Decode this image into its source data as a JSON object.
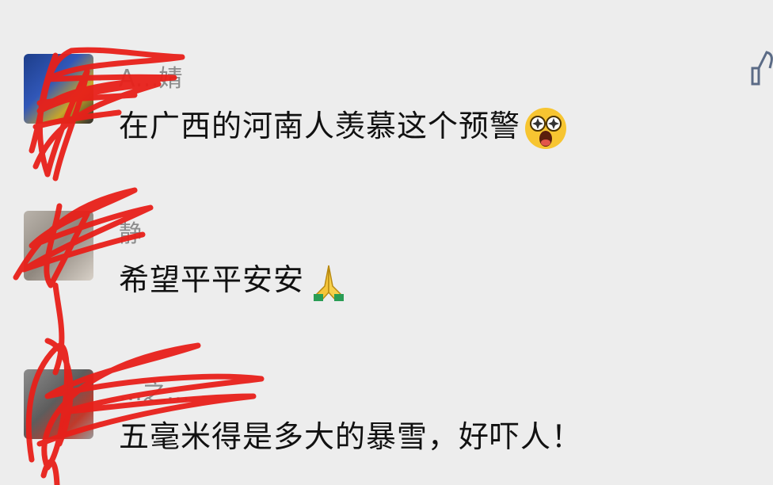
{
  "comments": [
    {
      "username": "A…婧",
      "text": "在广西的河南人羡慕这个预警",
      "emoji": "starstruck-face"
    },
    {
      "username": "静",
      "text": "希望平平安安",
      "emoji": "folded-hands"
    },
    {
      "username": "…之…",
      "text": "五毫米得是多大的暴雪，好吓人！",
      "emoji": ""
    }
  ],
  "icons": {
    "like": "thumbs-up-icon"
  },
  "colors": {
    "background": "#ededed",
    "text": "#111111",
    "username": "#8c8c8c",
    "redaction": "#e8201a"
  }
}
